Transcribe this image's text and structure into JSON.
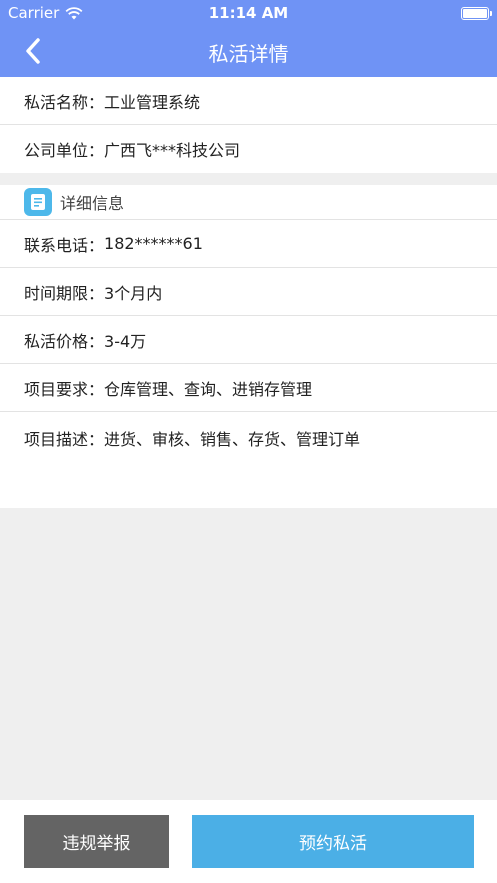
{
  "status_bar": {
    "carrier": "Carrier",
    "time": "11:14 AM"
  },
  "nav": {
    "title": "私活详情"
  },
  "summary": [
    {
      "label": "私活名称：",
      "value": "工业管理系统"
    },
    {
      "label": "公司单位：",
      "value": "广西飞***科技公司"
    }
  ],
  "detail": {
    "header": "详细信息",
    "rows": [
      {
        "label": "联系电话：",
        "value": "182******61"
      },
      {
        "label": "时间期限：",
        "value": "3个月内"
      },
      {
        "label": "私活价格：",
        "value": "3-4万"
      },
      {
        "label": "项目要求：",
        "value": "仓库管理、查询、进销存管理"
      },
      {
        "label": "项目描述：",
        "value": "进货、审核、销售、存货、管理订单"
      }
    ]
  },
  "actions": {
    "report_label": "违规举报",
    "book_label": "预约私活"
  },
  "colors": {
    "nav": "#6f93f5",
    "primary_button": "#4bafe6",
    "secondary_button": "#646464"
  }
}
